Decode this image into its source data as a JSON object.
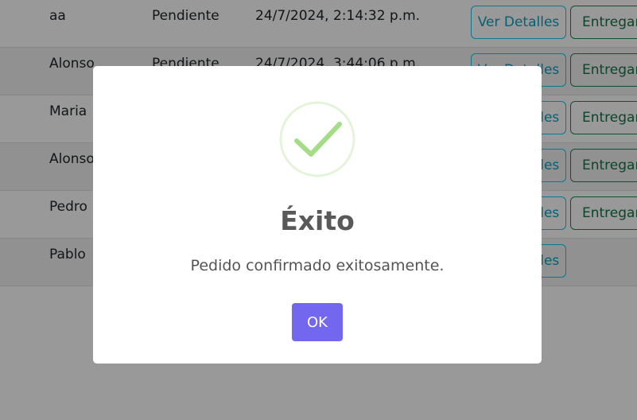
{
  "table": {
    "rows": [
      {
        "name": "aa",
        "status": "Pendiente",
        "date": "24/7/2024, 2:14:32 p.m.",
        "detail_label": "Ver Detalles",
        "deliver_label": "Entregar"
      },
      {
        "name": "Alonso",
        "status": "Pendiente",
        "date": "24/7/2024, 3:44:06 p.m.",
        "detail_label": "Ver Detalles",
        "deliver_label": "Entregar"
      },
      {
        "name": "Maria",
        "status": "",
        "date": "",
        "detail_label": "Ver Detalles",
        "deliver_label": "Entregar"
      },
      {
        "name": "Alonso",
        "status": "",
        "date": "",
        "detail_label": "Ver Detalles",
        "deliver_label": "Entregar"
      },
      {
        "name": "Pedro",
        "status": "",
        "date": "",
        "detail_label": "Ver Detalles",
        "deliver_label": "Entregar"
      },
      {
        "name": "Pablo",
        "status": "",
        "date": "",
        "detail_label": "Ver Detalles",
        "deliver_label": ""
      }
    ]
  },
  "modal": {
    "icon": "success-check-icon",
    "title": "Éxito",
    "message": "Pedido confirmado exitosamente.",
    "ok_label": "OK"
  },
  "colors": {
    "accent": "#7367f0",
    "success": "#a5dc86",
    "info": "#0dcaf0",
    "deliver": "#198754"
  }
}
